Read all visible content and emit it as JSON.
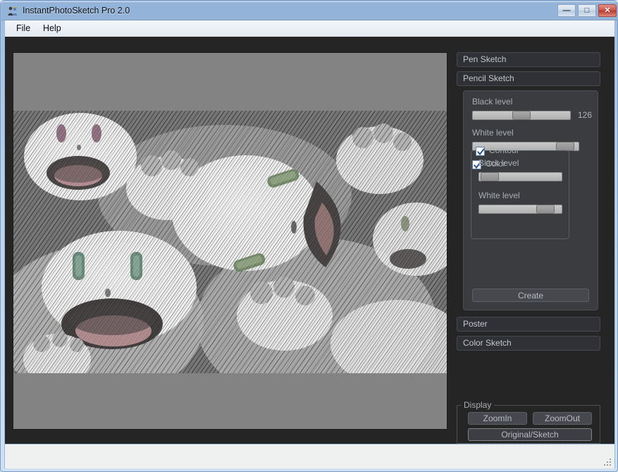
{
  "window": {
    "title": "InstantPhotoSketch Pro 2.0",
    "icon": "app-people-icon",
    "buttons": {
      "minimize": "—",
      "maximize": "□",
      "close": "✕"
    }
  },
  "menubar": {
    "items": [
      {
        "label": "File"
      },
      {
        "label": "Help"
      }
    ]
  },
  "accordion": {
    "pen_sketch": "Pen Sketch",
    "pencil_sketch": "Pencil Sketch",
    "poster": "Poster",
    "color_sketch": "Color Sketch"
  },
  "pencil_panel": {
    "black_level_label": "Black level",
    "black_level_value": "126",
    "black_level_percent": 49,
    "white_level_label": "White level",
    "white_level_percent": 94,
    "color_checkbox": {
      "label": "Color",
      "checked": true
    },
    "contour": {
      "checkbox_label": "Contour",
      "checked": true,
      "black_level_label": "Black level",
      "black_level_percent": 2,
      "white_level_label": "White level",
      "white_level_percent": 87
    },
    "create_button": "Create"
  },
  "display": {
    "legend": "Display",
    "zoom_in": "ZoomIn",
    "zoom_out": "ZoomOut",
    "original_sketch": "Original/Sketch"
  },
  "colors": {
    "titlebar": "#94b3d8",
    "frame": "#b9d2ea",
    "client_bg": "#252525",
    "panel_bg": "#3a3c40",
    "accent_check": "#2b5797",
    "canvas_bg": "#838383",
    "close_button": "#cf5246"
  }
}
